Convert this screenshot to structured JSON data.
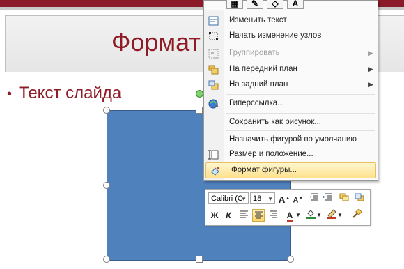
{
  "slide": {
    "title": "Формат",
    "bullet": "Текст слайда"
  },
  "menu": {
    "items": [
      {
        "label": "Изменить текст",
        "icon": "edit-text-icon",
        "enabled": true
      },
      {
        "label": "Начать изменение узлов",
        "icon": "edit-points-icon",
        "enabled": true
      },
      {
        "label": "Группировать",
        "icon": "group-icon",
        "enabled": false,
        "submenu": true
      },
      {
        "label": "На передний план",
        "icon": "bring-front-icon",
        "enabled": true,
        "submenu": true
      },
      {
        "label": "На задний план",
        "icon": "send-back-icon",
        "enabled": true,
        "submenu": true
      },
      {
        "label": "Гиперссылка...",
        "icon": "hyperlink-icon",
        "enabled": true
      },
      {
        "label": "Сохранить как рисунок...",
        "icon": "",
        "enabled": true
      },
      {
        "label": "Назначить фигурой по умолчанию",
        "icon": "",
        "enabled": true
      },
      {
        "label": "Размер и положение...",
        "icon": "size-position-icon",
        "enabled": true
      },
      {
        "label": "Формат фигуры...",
        "icon": "format-shape-icon",
        "enabled": true,
        "highlighted": true
      }
    ]
  },
  "minitoolbar": {
    "font": "Calibri (С",
    "size": "18",
    "bold": "Ж",
    "italic": "К",
    "grow_font": "A",
    "shrink_font": "A",
    "font_color_letter": "A"
  },
  "colors": {
    "shape_fill": "#4f81bd",
    "title_color": "#8e1b26",
    "highlight": "#fde18c"
  }
}
